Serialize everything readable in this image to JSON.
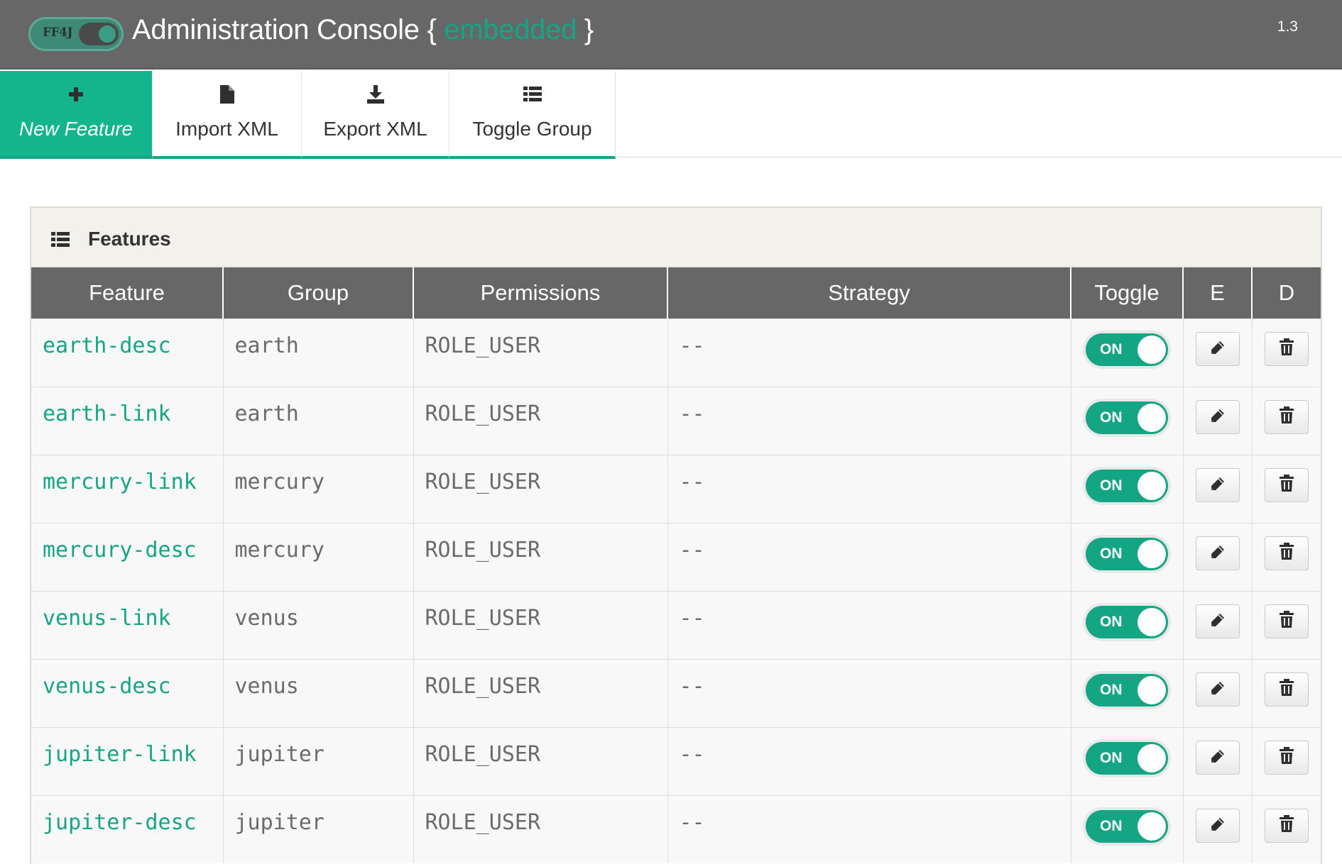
{
  "header": {
    "logo_text": "FF4J",
    "title_prefix": "Administration Console { ",
    "mode": "embedded",
    "title_suffix": " }",
    "version": "1.3"
  },
  "toolbar": {
    "buttons": [
      {
        "label": "New Feature",
        "icon": "plus-icon"
      },
      {
        "label": "Import XML",
        "icon": "file-icon"
      },
      {
        "label": "Export XML",
        "icon": "download-icon"
      },
      {
        "label": "Toggle Group",
        "icon": "list-icon"
      }
    ]
  },
  "panel": {
    "title": "Features",
    "icon": "list-icon"
  },
  "table": {
    "columns": [
      "Feature",
      "Group",
      "Permissions",
      "Strategy",
      "Toggle",
      "E",
      "D"
    ],
    "rows": [
      {
        "feature": "earth-desc",
        "group": "earth",
        "permissions": "ROLE_USER",
        "strategy": "--",
        "toggle": "ON"
      },
      {
        "feature": "earth-link",
        "group": "earth",
        "permissions": "ROLE_USER",
        "strategy": "--",
        "toggle": "ON"
      },
      {
        "feature": "mercury-link",
        "group": "mercury",
        "permissions": "ROLE_USER",
        "strategy": "--",
        "toggle": "ON"
      },
      {
        "feature": "mercury-desc",
        "group": "mercury",
        "permissions": "ROLE_USER",
        "strategy": "--",
        "toggle": "ON"
      },
      {
        "feature": "venus-link",
        "group": "venus",
        "permissions": "ROLE_USER",
        "strategy": "--",
        "toggle": "ON"
      },
      {
        "feature": "venus-desc",
        "group": "venus",
        "permissions": "ROLE_USER",
        "strategy": "--",
        "toggle": "ON"
      },
      {
        "feature": "jupiter-link",
        "group": "jupiter",
        "permissions": "ROLE_USER",
        "strategy": "--",
        "toggle": "ON"
      },
      {
        "feature": "jupiter-desc",
        "group": "jupiter",
        "permissions": "ROLE_USER",
        "strategy": "--",
        "toggle": "ON"
      }
    ]
  },
  "colors": {
    "accent": "#14a584",
    "header_bg": "#676767"
  }
}
